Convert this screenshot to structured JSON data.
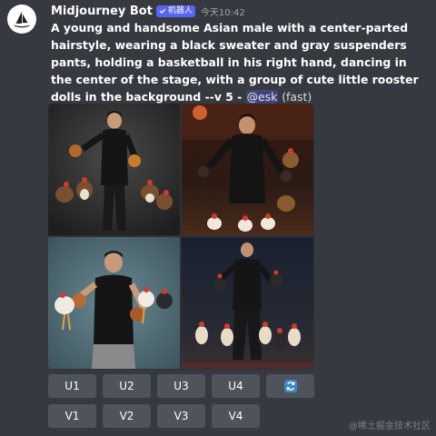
{
  "message": {
    "bot_name": "Midjourney Bot",
    "badge_label": "机器人",
    "timestamp": "今天10:42",
    "prompt_text": "A young and handsome Asian male with a center-parted hairstyle, wearing a black sweater and gray suspenders pants, holding a basketball in his right hand, dancing in the center of the stage, with a group of cute little rooster dolls in the background --v 5",
    "dash": " - ",
    "mention": "@esk",
    "speed": " (fast)"
  },
  "icons": {
    "avatar": "midjourney-sailboat-icon",
    "badge": "checkmark-icon",
    "refresh": "refresh-icon"
  },
  "upscale_buttons": [
    "U1",
    "U2",
    "U3",
    "U4"
  ],
  "variation_buttons": [
    "V1",
    "V2",
    "V3",
    "V4"
  ],
  "colors": {
    "background": "#36393f",
    "button": "#4f545c",
    "badge": "#5865f2",
    "refresh_icon": "#5db0ff"
  },
  "watermark": "@稀土掘金技术社区"
}
